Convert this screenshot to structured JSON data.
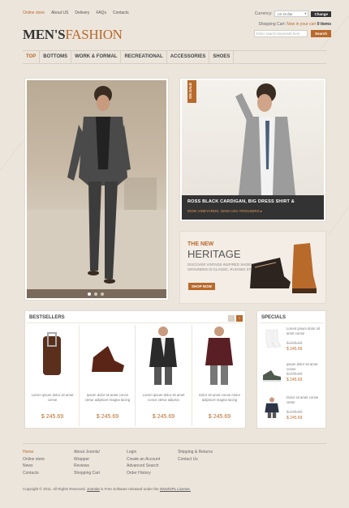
{
  "toplinks": [
    "Online store",
    "About US",
    "Delivery",
    "FAQs",
    "Contacts"
  ],
  "currency": {
    "label": "Currency:",
    "value": "US Dollar",
    "button": "Change"
  },
  "cart": {
    "label": "Shopping Cart:",
    "status": "Now in your cart",
    "count": "0 items"
  },
  "search": {
    "placeholder": "Enter search keywords here",
    "button": "Search"
  },
  "logo": {
    "part1": "MEN'S",
    "part2": "FASHION"
  },
  "menu": [
    "TOP",
    "BOTTOMS",
    "WORK & FORMAL",
    "RECREATIONAL",
    "ACCESSORIES",
    "SHOES"
  ],
  "promo1": {
    "badge": "ON SALE",
    "title": "ROSS BLACK CARDIGAN, BIG DRESS SHIRT &",
    "sub": "IRON VINEYARDS, GINO USA TROUSERS ▸"
  },
  "promo2": {
    "kicker": "THE NEW",
    "title": "HERITAGE",
    "desc": "DISCOVER VINTAGE-INSPIRED SHOES GROUNDED IN CLASSIC, RUGGED STYLE.",
    "button": "SHOP NOW"
  },
  "bestsellers": {
    "title": "BESTSELLERS",
    "prev": "‹",
    "next": "›",
    "items": [
      {
        "desc": "Lorem ipsum dolor sit amet conse",
        "price": "$ 245.69",
        "icon": "belt-icon"
      },
      {
        "desc": "Ipsum dolor sit amet conce ctetur adipiscel magna lacing",
        "price": "$ 245.69",
        "icon": "boot-icon"
      },
      {
        "desc": "Lorem ipsum dolor sit amet conce ctetur adipisci",
        "price": "$ 245.69",
        "icon": "blazer-icon"
      },
      {
        "desc": "Dolor sit amet conse ctetur adipiscel magna lacing",
        "price": "$ 245.69",
        "icon": "sweater-icon"
      }
    ]
  },
  "specials": {
    "title": "SPECIALS",
    "items": [
      {
        "desc": "Lorem ipsum dolor sit amet conse",
        "old": "$ 245.69",
        "price": "$ 245.69",
        "icon": "socks-icon"
      },
      {
        "desc": "ipsum dolor sit amet conse",
        "old": "$ 245.69",
        "price": "$ 245.69",
        "icon": "sneaker-icon"
      },
      {
        "desc": "Dolor sit amet conse ctetur",
        "old": "$ 245.69",
        "price": "$ 245.69",
        "icon": "shirt-icon"
      }
    ]
  },
  "footer": {
    "col1": [
      "Home",
      "Online store",
      "News",
      "Contacts"
    ],
    "col2": [
      "About Joomla!",
      "Wrapper",
      "Reviews",
      "Shopping Cart"
    ],
    "col3": [
      "Login",
      "Create an Account",
      "Advanced Search",
      "Order History"
    ],
    "col4": [
      "Shipping & Returns",
      "Contact Us"
    ],
    "copyright_pre": "Copyright © 2011. All Rights Reserved.",
    "joomla": "Joomla!",
    "copyright_mid": "is Free Software released under the",
    "license": "GNU/GPL License."
  },
  "colors": {
    "accent": "#b8692b",
    "bg": "#ece5dc",
    "dark": "#333333"
  }
}
